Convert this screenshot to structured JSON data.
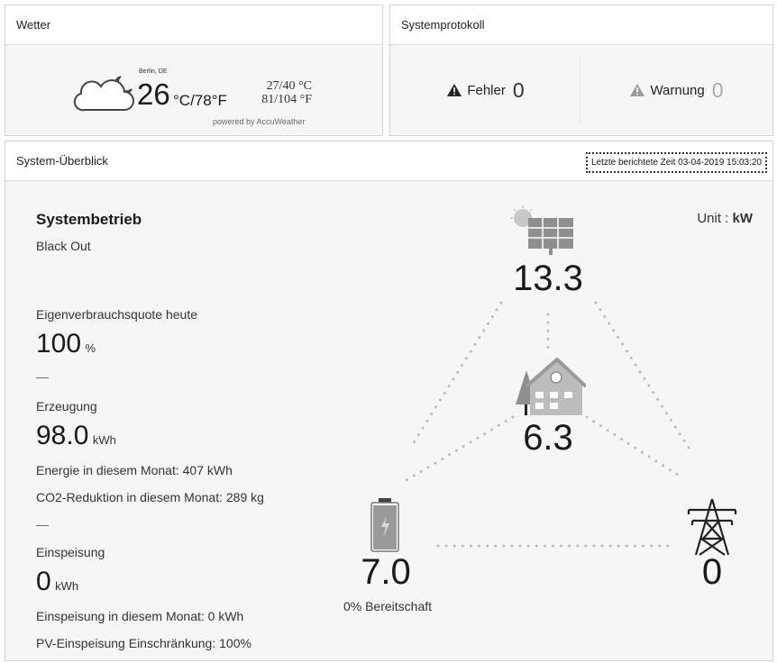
{
  "weather": {
    "title": "Wetter",
    "city": "Berlin, DE",
    "temp_c": "26",
    "temp_unit": "°C/78°F",
    "range_c": "27/40 °C",
    "range_f": "81/104 °F",
    "powered": "powered by AccuWeather",
    "icon": "cloud-moon-icon"
  },
  "syslog": {
    "title": "Systemprotokoll",
    "error_label": "Fehler",
    "error_count": "0",
    "warning_label": "Warnung",
    "warning_count": "0"
  },
  "overview": {
    "title": "System-Überblick",
    "timestamp": "Letzte berichtete Zeit 03-04-2019 15:03:20",
    "unit_prefix": "Unit : ",
    "unit": "kW",
    "operation_title": "Systembetrieb",
    "operation_status": "Black Out",
    "self_consumption_label": "Eigenverbrauchsquote heute",
    "self_consumption_value": "100",
    "self_consumption_unit": "%",
    "divider": "—",
    "generation_label": "Erzeugung",
    "generation_value": "98.0",
    "generation_unit": "kWh",
    "energy_month": "Energie in diesem Monat: 407 kWh",
    "co2_month": "CO2-Reduktion in diesem Monat: 289 kg",
    "feedin_label": "Einspeisung",
    "feedin_value": "0",
    "feedin_unit": "kWh",
    "feedin_month": "Einspeisung in diesem Monat: 0 kWh",
    "pv_limit": "PV-Einspeisung Einschränkung: 100%",
    "flow": {
      "pv_value": "13.3",
      "home_value": "6.3",
      "battery_value": "7.0",
      "battery_sub": "0% Bereitschaft",
      "grid_value": "0"
    },
    "colors": {
      "icon_gray": "#8f8f8f",
      "battery_fill": "#9a9a9a",
      "dots": "#bdbdbd"
    }
  }
}
